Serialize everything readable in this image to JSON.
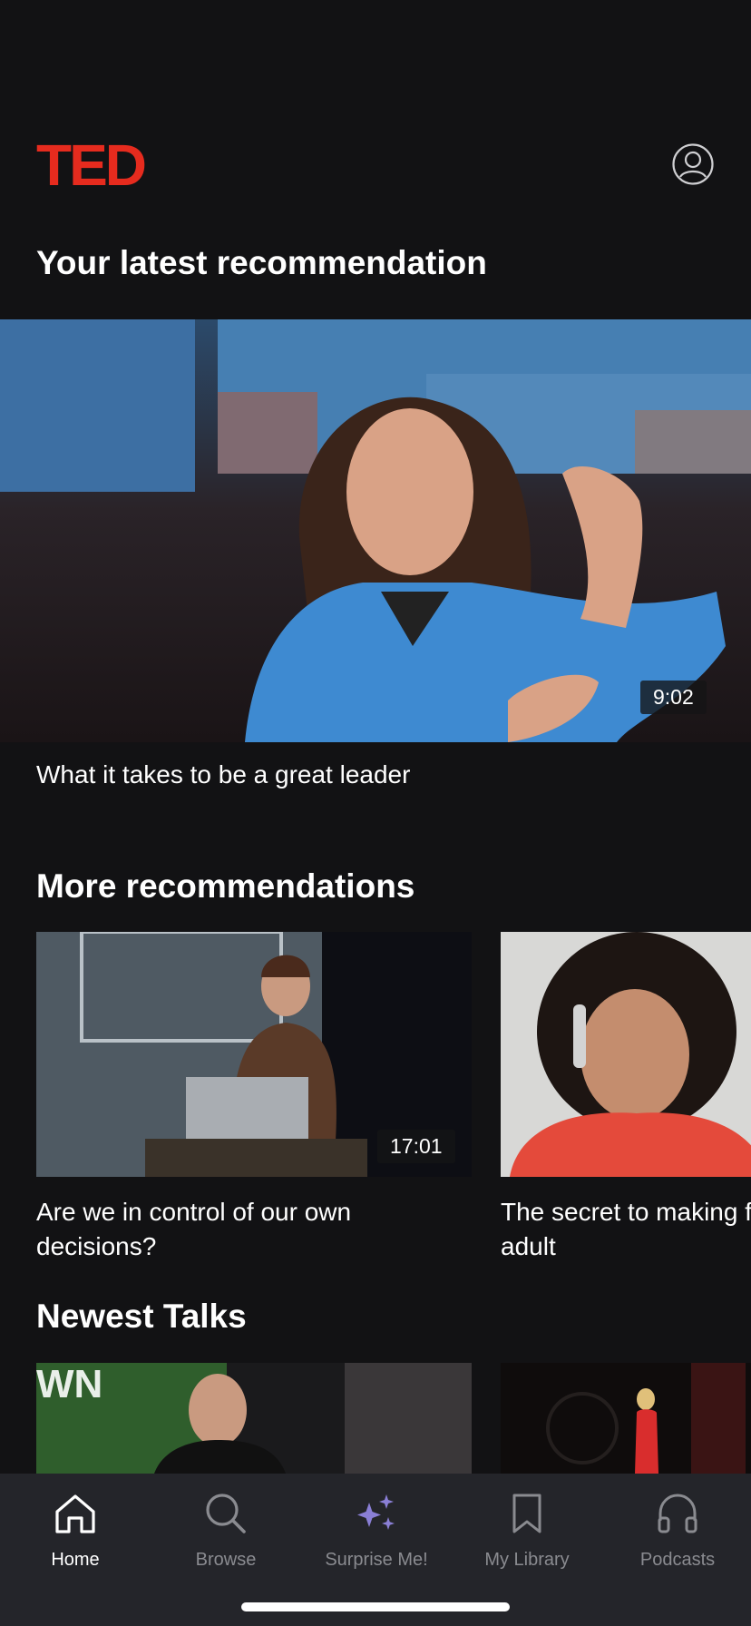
{
  "header": {
    "logo_text": "TED",
    "profile_icon": "user-circle-icon"
  },
  "latest": {
    "title": "Your latest recommendation",
    "talk": {
      "title": "What it takes to be a great leader",
      "duration": "9:02"
    }
  },
  "more": {
    "title": "More recommendations",
    "talks": [
      {
        "title": "Are we in control of our own decisions?",
        "duration": "17:01"
      },
      {
        "title": "The secret to making friends as an adult",
        "duration": ""
      }
    ]
  },
  "newest": {
    "title": "Newest Talks"
  },
  "tabs": [
    {
      "label": "Home",
      "icon": "home-icon",
      "active": true
    },
    {
      "label": "Browse",
      "icon": "search-icon",
      "active": false
    },
    {
      "label": "Surprise Me!",
      "icon": "sparkle-icon",
      "active": false
    },
    {
      "label": "My Library",
      "icon": "bookmark-icon",
      "active": false
    },
    {
      "label": "Podcasts",
      "icon": "headphones-icon",
      "active": false
    }
  ],
  "colors": {
    "brand": "#e62b1e",
    "background": "#121214",
    "tabbar": "#24252a",
    "accent": "#8a7fd6"
  }
}
